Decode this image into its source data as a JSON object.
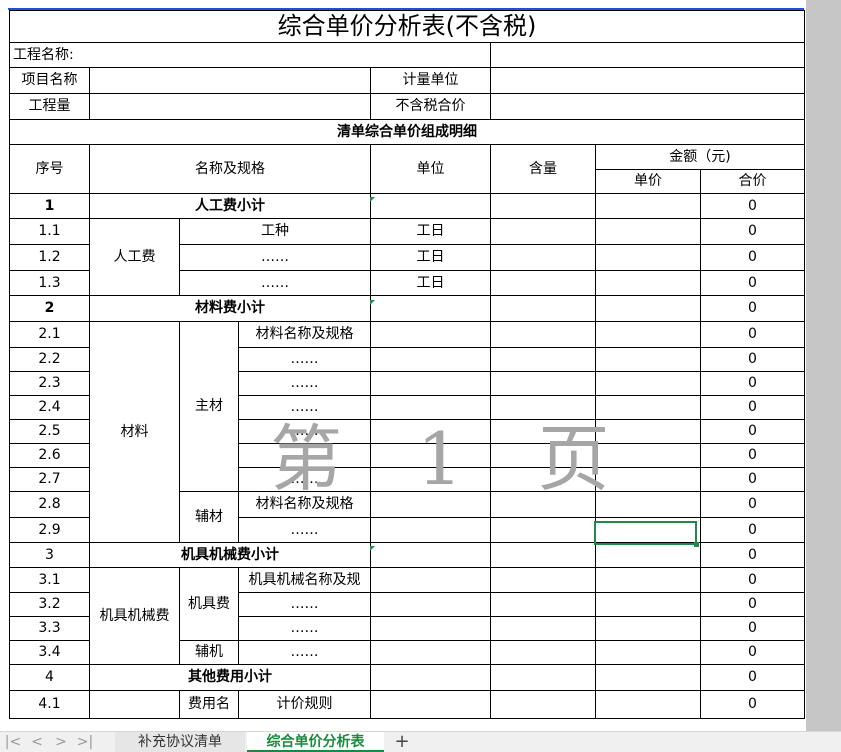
{
  "sheet": {
    "title": "综合单价分析表(不含税)",
    "project_name_label": "工程名称:",
    "item_name_label": "项目名称",
    "unit_label": "计量单位",
    "quantity_label": "工程量",
    "price_label": "不含税合价",
    "detail_header": "清单综合单价组成明细",
    "col_no": "序号",
    "col_name": "名称及规格",
    "col_unit": "单位",
    "col_qty": "含量",
    "col_amount": "金额（元)",
    "col_unit_price": "单价",
    "col_total": "合价",
    "watermark": "第 1 页",
    "rows": {
      "r1": {
        "no": "1",
        "name": "人工费小计",
        "total": "0"
      },
      "r1_1": {
        "no": "1.1",
        "group": "人工费",
        "name": "工种",
        "unit": "工日",
        "total": "0"
      },
      "r1_2": {
        "no": "1.2",
        "name": "……",
        "unit": "工日",
        "total": "0"
      },
      "r1_3": {
        "no": "1.3",
        "name": "……",
        "unit": "工日",
        "total": "0"
      },
      "r2": {
        "no": "2",
        "name": "材料费小计",
        "total": "0"
      },
      "r2_1": {
        "no": "2.1",
        "group": "材料",
        "sub": "主材",
        "name": "材料名称及规格",
        "total": "0"
      },
      "r2_2": {
        "no": "2.2",
        "name": "……",
        "total": "0"
      },
      "r2_3": {
        "no": "2.3",
        "name": "……",
        "total": "0"
      },
      "r2_4": {
        "no": "2.4",
        "name": "……",
        "total": "0"
      },
      "r2_5": {
        "no": "2.5",
        "name": "……",
        "total": "0"
      },
      "r2_6": {
        "no": "2.6",
        "name": "……",
        "total": "0"
      },
      "r2_7": {
        "no": "2.7",
        "name": "……",
        "total": "0"
      },
      "r2_8": {
        "no": "2.8",
        "sub": "辅材",
        "name": "材料名称及规格",
        "total": "0"
      },
      "r2_9": {
        "no": "2.9",
        "name": "……",
        "total": "0"
      },
      "r3": {
        "no": "3",
        "name": "机具机械费小计",
        "total": "0"
      },
      "r3_1": {
        "no": "3.1",
        "group": "机具机械费",
        "sub": "机具费",
        "name": "机具机械名称及规",
        "total": "0"
      },
      "r3_2": {
        "no": "3.2",
        "name": "……",
        "total": "0"
      },
      "r3_3": {
        "no": "3.3",
        "name": "……",
        "total": "0"
      },
      "r3_4": {
        "no": "3.4",
        "sub": "辅机",
        "name": "……",
        "total": "0"
      },
      "r4": {
        "no": "4",
        "name": "其他费用小计",
        "total": "0"
      },
      "r4_1": {
        "no": "4.1",
        "sub": "费用名",
        "name": "计价规则",
        "total": "0"
      }
    }
  },
  "tabs": {
    "sheet1": "补充协议清单",
    "sheet2": "综合单价分析表",
    "add": "+"
  },
  "nav": {
    "first": "|<",
    "prev": "<",
    "next": ">",
    "last": ">|"
  },
  "colors": {
    "selection": "#1f8a4c",
    "active_tab": "#1a8a3c",
    "frame": "#1f4fd6"
  }
}
